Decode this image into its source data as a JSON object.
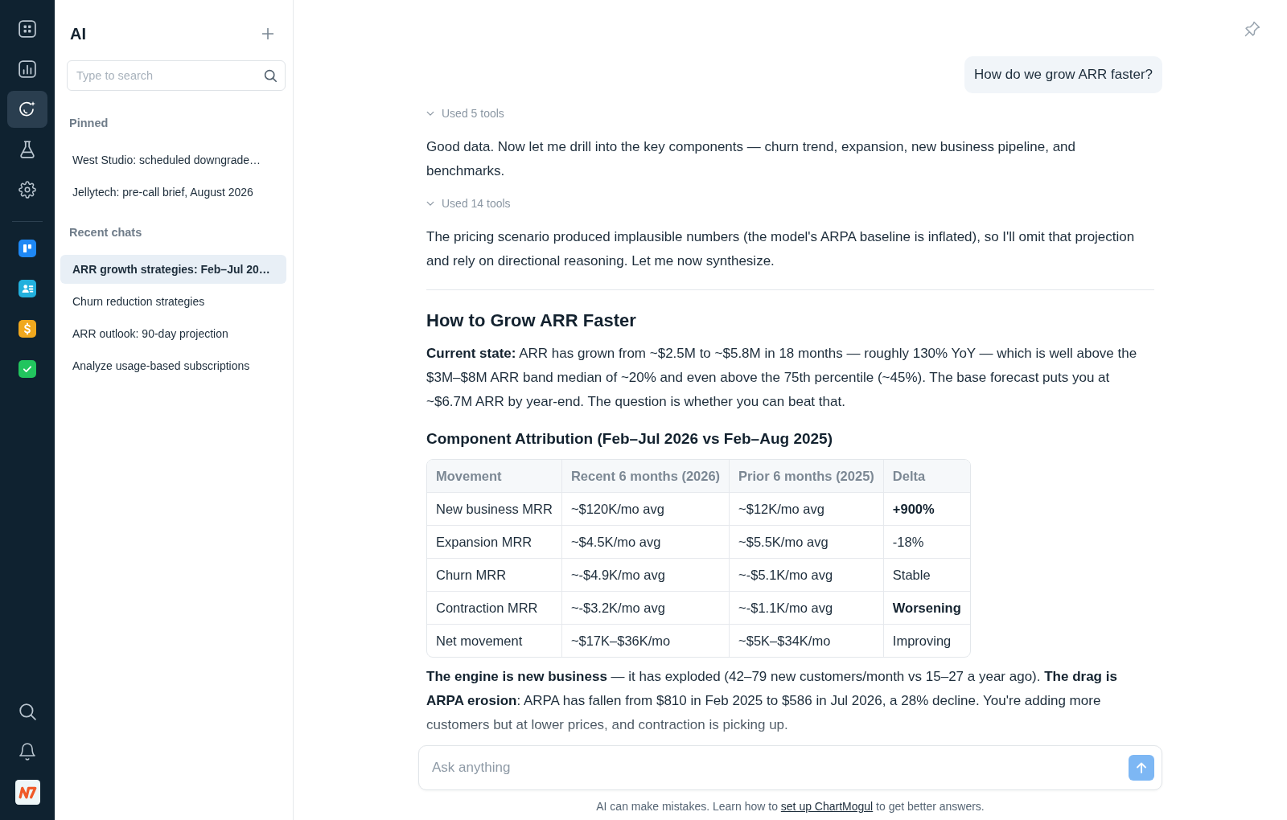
{
  "nav_rail": {
    "main_items": [
      {
        "selected": false
      },
      {
        "selected": false
      },
      {
        "selected": true
      },
      {
        "selected": false
      },
      {
        "selected": false
      }
    ],
    "apps": [
      {
        "color": "#1e88f5"
      },
      {
        "color": "#22b0dd"
      },
      {
        "color": "#f0a81e"
      },
      {
        "color": "#22c55e"
      }
    ]
  },
  "sidebar": {
    "title": "AI",
    "search": {
      "placeholder": "Type to search"
    },
    "sections": [
      {
        "heading": "Pinned",
        "items": [
          {
            "label": "West Studio: scheduled downgrade…",
            "selected": false
          },
          {
            "label": "Jellytech: pre-call brief, August 2026",
            "selected": false
          }
        ]
      },
      {
        "heading": "Recent chats",
        "items": [
          {
            "label": "ARR growth strategies: Feb–Jul 20…",
            "selected": true
          },
          {
            "label": "Churn reduction strategies",
            "selected": false
          },
          {
            "label": "ARR outlook: 90-day projection",
            "selected": false
          },
          {
            "label": "Analyze usage-based subscriptions",
            "selected": false
          }
        ]
      }
    ]
  },
  "chat": {
    "messages": [
      {
        "kind": "user",
        "text": "How do we grow ARR faster?"
      },
      {
        "kind": "tools",
        "label": "Used 5 tools"
      },
      {
        "kind": "paragraph",
        "text": "Good data. Now let me drill into the key components — churn trend, expansion, new business pipeline, and benchmarks."
      },
      {
        "kind": "tools",
        "label": "Used 14 tools"
      },
      {
        "kind": "paragraph",
        "text": "The pricing scenario produced implausible numbers (the model's ARPA baseline is inflated), so I'll omit that projection and rely on directional reasoning. Let me now synthesize."
      },
      {
        "kind": "divider"
      },
      {
        "kind": "heading",
        "text": "How to Grow ARR Faster"
      },
      {
        "kind": "paragraph",
        "text": "**Current state:** ARR has grown from ~$2.5M to ~$5.8M in 18 months — roughly 130% YoY — which is well above the $3M–$8M ARR band median of ~20% and even above the 75th percentile (~45%). The base forecast puts you at ~$6.7M ARR by year-end. The question is whether you can beat that."
      },
      {
        "kind": "subheading",
        "text": "Component Attribution (Feb–Jul 2026 vs Feb–Aug 2025)"
      },
      {
        "kind": "table",
        "columns": [
          "Movement",
          "Recent 6 months (2026)",
          "Prior 6 months (2025)",
          "Delta"
        ],
        "rows": [
          {
            "cells": [
              "New business MRR",
              "~$120K/mo avg",
              "~$12K/mo avg",
              "+900%"
            ],
            "bold_delta": true
          },
          {
            "cells": [
              "Expansion MRR",
              "~$4.5K/mo avg",
              "~$5.5K/mo avg",
              "-18%"
            ],
            "bold_delta": false
          },
          {
            "cells": [
              "Churn MRR",
              "~-$4.9K/mo avg",
              "~-$5.1K/mo avg",
              "Stable"
            ],
            "bold_delta": false
          },
          {
            "cells": [
              "Contraction MRR",
              "~-$3.2K/mo avg",
              "~-$1.1K/mo avg",
              "Worsening"
            ],
            "bold_delta": true
          },
          {
            "cells": [
              "Net movement",
              "~$17K–$36K/mo",
              "~$5K–$34K/mo",
              "Improving"
            ],
            "bold_delta": false
          }
        ]
      },
      {
        "kind": "paragraph",
        "text": "**The engine is new business** — it has exploded (42–79 new customers/month vs 15–27 a year ago). **The drag is ARPA erosion**: ARPA has fallen from $810 in Feb 2025 to $586 in Jul 2026, a 28% decline. You're adding more customers but at lower prices, and contraction is picking up."
      }
    ]
  },
  "composer": {
    "placeholder": "Ask anything"
  },
  "disclaimer": {
    "before": "AI can make mistakes. Learn how to",
    "link": "set up ChartMogul",
    "after": "to get better answers."
  }
}
